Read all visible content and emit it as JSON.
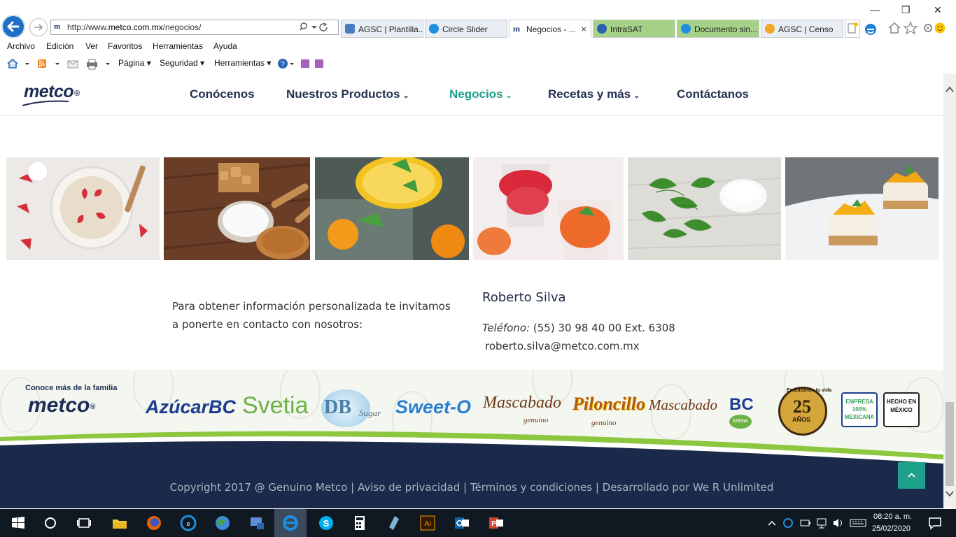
{
  "browser": {
    "url_prefix": "http://www.",
    "url_domain": "metco.com.mx",
    "url_path": "/negocios/",
    "tabs": [
      {
        "label": "AGSC | Plantilla..."
      },
      {
        "label": "Circle Slider"
      },
      {
        "label": "Negocios - ...",
        "close": "×"
      },
      {
        "label": "IntraSAT"
      },
      {
        "label": "Documento sin..."
      },
      {
        "label": "AGSC | Censo"
      }
    ],
    "menu": [
      "Archivo",
      "Edición",
      "Ver",
      "Favoritos",
      "Herramientas",
      "Ayuda"
    ],
    "command_bar": {
      "page": "Página ▾",
      "security": "Seguridad ▾",
      "tools": "Herramientas ▾"
    },
    "window_controls": {
      "minimize": "—",
      "restore": "❐",
      "close": "✕"
    }
  },
  "site": {
    "logo": "metco",
    "logo_mark": "®",
    "nav": [
      {
        "label": "Conócenos",
        "dropdown": false
      },
      {
        "label": "Nuestros Productos",
        "dropdown": true
      },
      {
        "label": "Negocios",
        "dropdown": true,
        "active": true
      },
      {
        "label": "Recetas y más",
        "dropdown": true
      },
      {
        "label": "Contáctanos",
        "dropdown": false
      }
    ],
    "chevron": "⌄"
  },
  "content": {
    "info_text": "Para obtener información personalizada te invitamos a ponerte en contacto con nosotros:",
    "contact_name": "Roberto Silva",
    "phone_label": "Teléfono:",
    "phone_value": " (55) 30 98 40 00 Ext. 6308",
    "email": "roberto.silva@metco.com.mx"
  },
  "brands": {
    "family_label": "Conoce más de la familia",
    "family_logo": "metco",
    "items": [
      "AzúcarBC",
      "Svetia",
      "DB",
      "Sugar",
      "Sweet-O",
      "Mascabado",
      "genuino",
      "Piloncillo",
      "genuino",
      "Mascabado",
      "BC",
      "STEVIA",
      "25",
      "AÑOS",
      "Endulzando tu vida",
      "EMPRESA 100% MEXICANA",
      "HECHO EN MÉXICO"
    ]
  },
  "footer": {
    "copyright": "Copyright 2017 @ Genuino Metco | Aviso de privacidad | Términos y condiciones | Desarrollado por We R Unlimited"
  },
  "taskbar": {
    "time": "08:20 a. m.",
    "date": "25/02/2020"
  },
  "colors": {
    "nav_text": "#22314f",
    "nav_active": "#1ea08a",
    "footer_bg": "#1b2a4a",
    "accent_green": "#8dc63f"
  }
}
